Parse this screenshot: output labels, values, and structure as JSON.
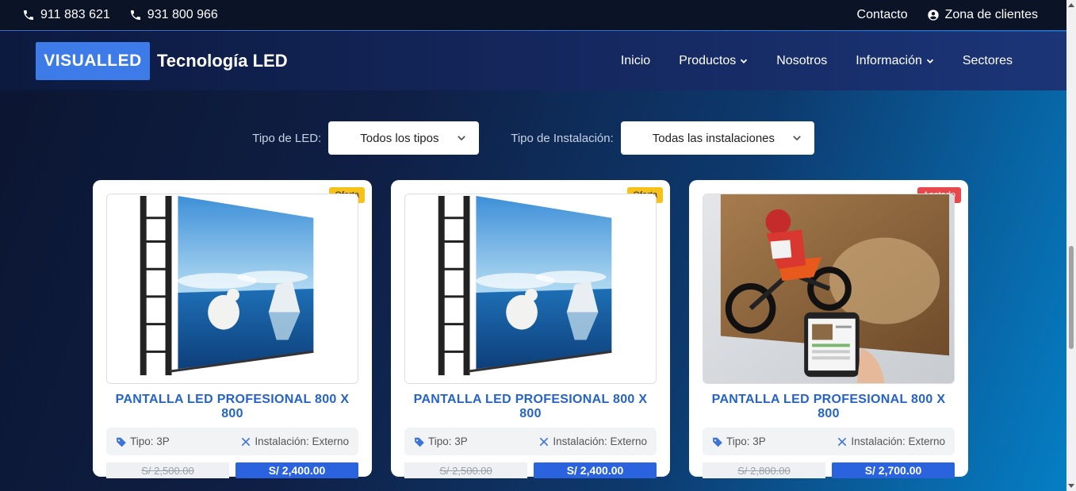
{
  "topbar": {
    "phones": [
      "911 883 621",
      "931 800 966"
    ],
    "contact": "Contacto",
    "clients": "Zona de clientes"
  },
  "brand": {
    "logo": "VISUALLED",
    "tagline": "Tecnología LED"
  },
  "nav": {
    "items": [
      "Inicio",
      "Productos",
      "Nosotros",
      "Información",
      "Sectores"
    ]
  },
  "filters": {
    "led_label": "Tipo de LED:",
    "led_value": "Todos los tipos",
    "install_label": "Tipo de Instalación:",
    "install_value": "Todas las instalaciones"
  },
  "products": [
    {
      "badge": "Oferta",
      "title": "PANTALLA LED PROFESIONAL 800 X 800",
      "type": "Tipo: 3P",
      "install": "Instalación: Externo",
      "old_price": "S/ 2,500.00",
      "price": "S/ 2,400.00",
      "image": "polar-bear-led-wall"
    },
    {
      "badge": "Oferta",
      "title": "PANTALLA LED PROFESIONAL 800 X 800",
      "type": "Tipo: 3P",
      "install": "Instalación: Externo",
      "old_price": "S/ 2,500.00",
      "price": "S/ 2,400.00",
      "image": "polar-bear-led-wall"
    },
    {
      "badge": "Agotado",
      "title": "PANTALLA LED PROFESIONAL 800 X 800",
      "type": "Tipo: 3P",
      "install": "Instalación: Externo",
      "old_price": "S/ 2,800.00",
      "price": "S/ 2,700.00",
      "image": "motocross-led-screen"
    }
  ],
  "colors": {
    "brand_blue": "#3c7be8",
    "title_blue": "#2563c9",
    "price_blue": "#2a63dd",
    "offer_yellow": "#f6c21a",
    "soldout_red": "#e8474b"
  }
}
